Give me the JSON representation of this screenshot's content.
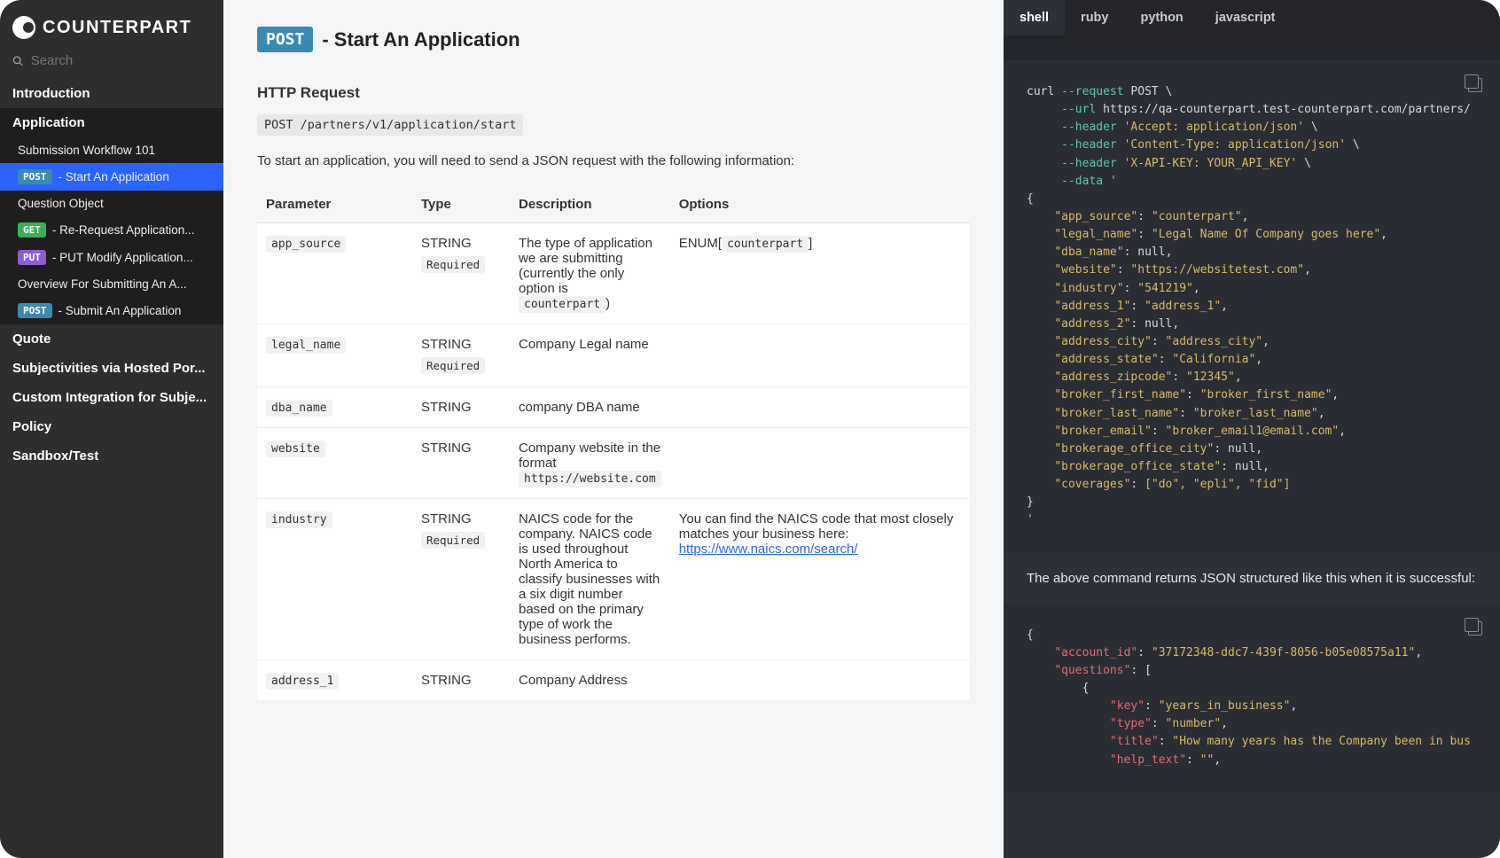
{
  "brand": "COUNTERPART",
  "search_placeholder": "Search",
  "nav": {
    "intro": "Introduction",
    "app": "Application",
    "sub": {
      "workflow": "Submission Workflow 101",
      "start": " - Start An Application",
      "question": "Question Object",
      "rereq": " - Re-Request Application...",
      "put": " - PUT Modify Application...",
      "overview": "Overview For Submitting An A...",
      "submit": " - Submit An Application"
    },
    "quote": "Quote",
    "subj": "Subjectivities via Hosted Por...",
    "custom": "Custom Integration for Subje...",
    "policy": "Policy",
    "sandbox": "Sandbox/Test"
  },
  "title_method": "POST",
  "title_text": " - Start An Application",
  "section_http": "HTTP Request",
  "http_line": "POST /partners/v1/application/start",
  "intro_para": "To start an application, you will need to send a JSON request with the following information:",
  "headers": {
    "param": "Parameter",
    "type": "Type",
    "desc": "Description",
    "opts": "Options"
  },
  "rows": [
    {
      "param": "app_source",
      "type": "STRING",
      "req": true,
      "desc_pre": "The type of application we are submitting (currently the only option is ",
      "desc_code": "counterpart",
      "desc_post": ")",
      "opts_pre": "ENUM[",
      "opts_code": "counterpart",
      "opts_post": "]"
    },
    {
      "param": "legal_name",
      "type": "STRING",
      "req": true,
      "desc": "Company Legal name"
    },
    {
      "param": "dba_name",
      "type": "STRING",
      "desc": "company DBA name"
    },
    {
      "param": "website",
      "type": "STRING",
      "desc_pre": "Company website in the format ",
      "desc_code": "https://website.com"
    },
    {
      "param": "industry",
      "type": "STRING",
      "req": true,
      "desc": "NAICS code for the company. NAICS code is used throughout North America to classify businesses with a six digit number based on the primary type of work the business performs.",
      "opts_text": "You can find the NAICS code that most closely matches your business here: ",
      "opts_link": "https://www.naics.com/search/"
    },
    {
      "param": "address_1",
      "type": "STRING",
      "desc": "Company Address"
    }
  ],
  "tabs": [
    "shell",
    "ruby",
    "python",
    "javascript"
  ],
  "response_note": "The above command returns JSON structured like this when it is successful:",
  "code1": {
    "l1a": "curl ",
    "l1b": "--request",
    "l1c": " POST \\",
    "l2a": "--url",
    "l2b": " https://qa-counterpart.test-counterpart.com/partners/",
    "l3a": "--header ",
    "l3b": "'Accept: application/json'",
    "l3c": " \\",
    "l4a": "--header ",
    "l4b": "'Content-Type: application/json'",
    "l4c": " \\",
    "l5a": "--header ",
    "l5b": "'X-API-KEY: YOUR_API_KEY'",
    "l5c": " \\",
    "l6a": "--data ",
    "l6b": "'",
    "b1": "{",
    "k1": "\"app_source\"",
    "v1": "\"counterpart\"",
    "k2": "\"legal_name\"",
    "v2": "\"Legal Name Of Company goes here\"",
    "k3": "\"dba_name\"",
    "v3": "null",
    "k4": "\"website\"",
    "v4": "\"https://websitetest.com\"",
    "k5": "\"industry\"",
    "v5": "\"541219\"",
    "k6": "\"address_1\"",
    "v6": "\"address_1\"",
    "k7": "\"address_2\"",
    "v7": "null",
    "k8": "\"address_city\"",
    "v8": "\"address_city\"",
    "k9": "\"address_state\"",
    "v9": "\"California\"",
    "k10": "\"address_zipcode\"",
    "v10": "\"12345\"",
    "k11": "\"broker_first_name\"",
    "v11": "\"broker_first_name\"",
    "k12": "\"broker_last_name\"",
    "v12": "\"broker_last_name\"",
    "k13": "\"broker_email\"",
    "v13": "\"broker_email1@email.com\"",
    "k14": "\"brokerage_office_city\"",
    "v14": "null",
    "k15": "\"brokerage_office_state\"",
    "v15": "null",
    "k16": "\"coverages\"",
    "v16": "[\"do\", \"epli\", \"fid\"]",
    "b2": "}",
    "b3": "'"
  },
  "code2": {
    "b1": "{",
    "k1": "\"account_id\"",
    "v1": "\"37172348-ddc7-439f-8056-b05e08575a11\"",
    "k2": "\"questions\"",
    "v2": "[",
    "b2": "{",
    "k3": "\"key\"",
    "v3": "\"years_in_business\"",
    "k4": "\"type\"",
    "v4": "\"number\"",
    "k5": "\"title\"",
    "v5": "\"How many years has the Company been in bus",
    "k6": "\"help_text\"",
    "v6": "\"\""
  }
}
